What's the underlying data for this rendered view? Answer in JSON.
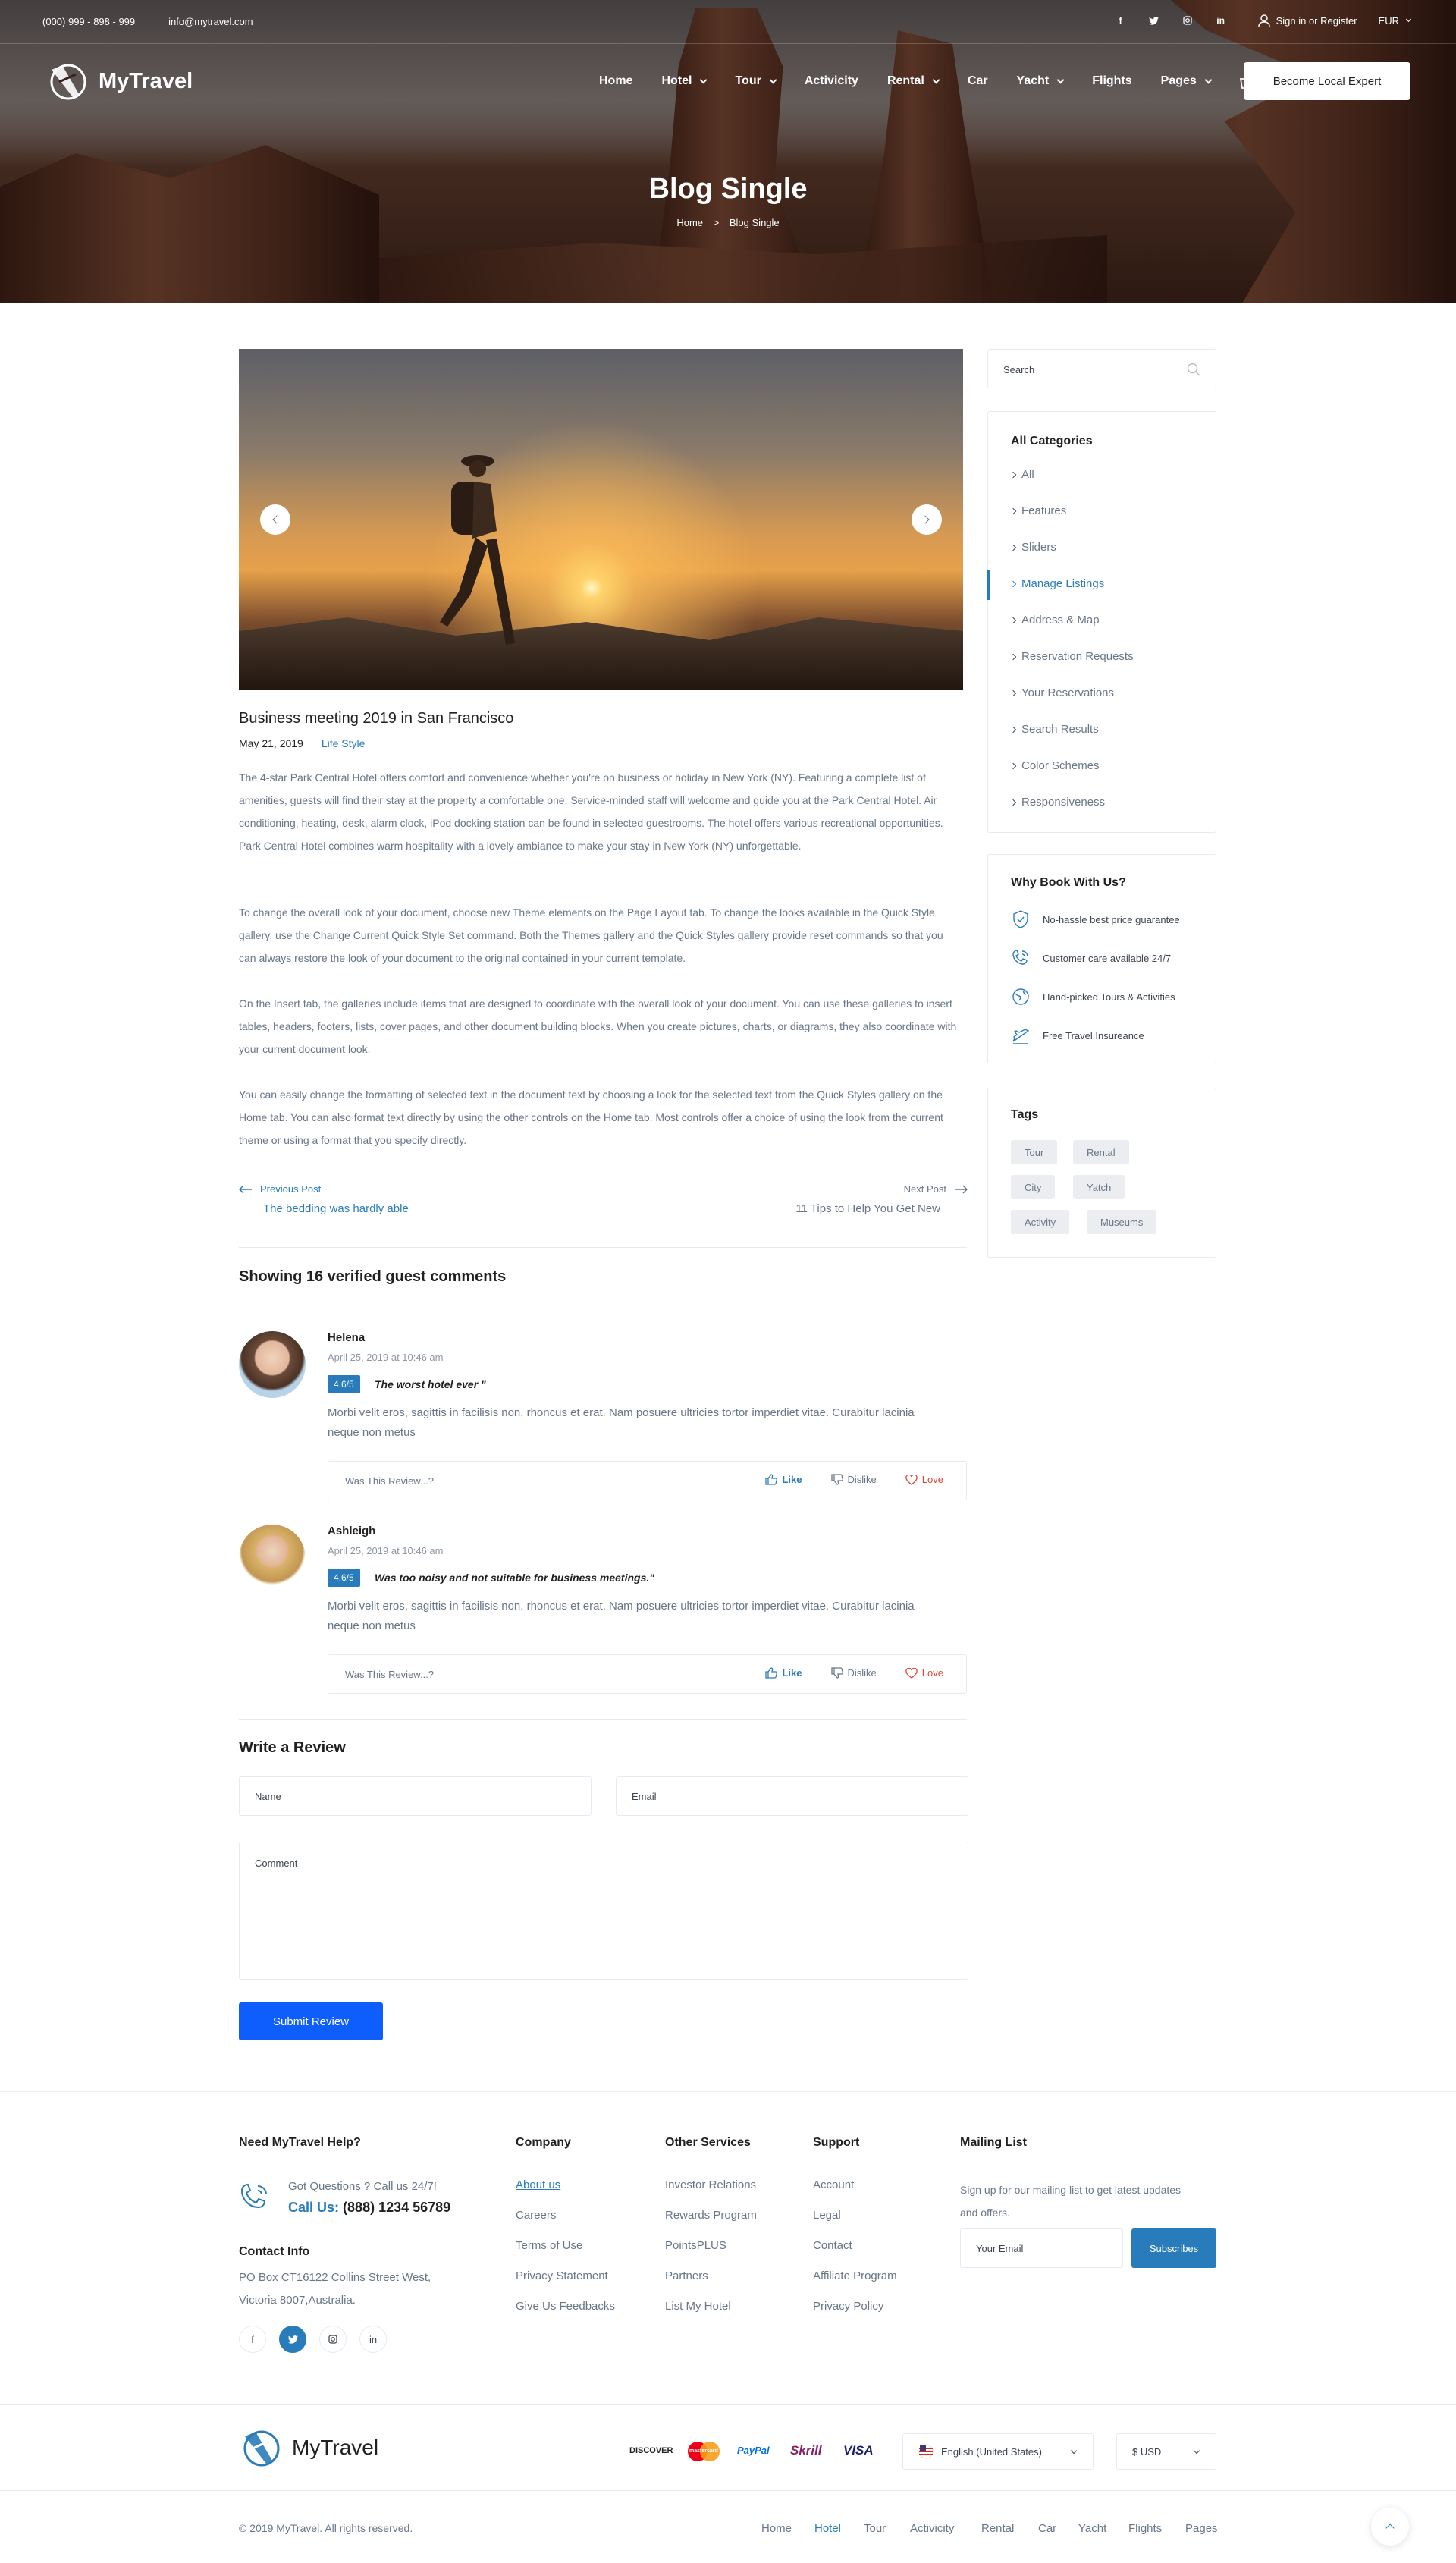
{
  "topbar": {
    "phone": "(000) 999 - 898 - 999",
    "email": "info@mytravel.com",
    "signin": "Sign in or Register",
    "currency": "EUR"
  },
  "brand": {
    "name": "MyTravel"
  },
  "nav": {
    "items": [
      {
        "label": "Home",
        "dropdown": false
      },
      {
        "label": "Hotel",
        "dropdown": true
      },
      {
        "label": "Tour",
        "dropdown": true
      },
      {
        "label": "Activicity",
        "dropdown": false
      },
      {
        "label": "Rental",
        "dropdown": true
      },
      {
        "label": "Car",
        "dropdown": false
      },
      {
        "label": "Yacht",
        "dropdown": true
      },
      {
        "label": "Flights",
        "dropdown": false
      },
      {
        "label": "Pages",
        "dropdown": true
      }
    ],
    "cta": "Become Local Expert"
  },
  "hero": {
    "title": "Blog Single",
    "crumb_home": "Home",
    "crumb_sep": ">",
    "crumb_current": "Blog Single"
  },
  "post": {
    "title": "Business meeting 2019 in San Francisco",
    "date": "May 21, 2019",
    "category": "Life Style",
    "paragraphs": [
      "The 4-star Park Central Hotel offers comfort and convenience whether you're on business or holiday in New York (NY). Featuring a complete list of amenities, guests will find their stay at the property a comfortable one. Service-minded staff will welcome and guide you at the Park Central Hotel. Air conditioning, heating, desk, alarm clock, iPod docking station can be found in selected guestrooms. The hotel offers various recreational opportunities. Park Central Hotel combines warm hospitality with a lovely ambiance to make your stay in New York (NY) unforgettable.",
      "To change the overall look of your document, choose new Theme elements on the Page Layout tab. To change the looks available in the Quick Style gallery, use the Change Current Quick Style Set command. Both the Themes gallery and the Quick Styles gallery provide reset commands so that you can always restore the look of your document to the original contained in your current template.",
      "On the Insert tab, the galleries include items that are designed to coordinate with the overall look of your document. You can use these galleries to insert tables, headers, footers, lists, cover pages, and other document building blocks. When you create pictures, charts, or diagrams, they also coordinate with your current document look.",
      "You can easily change the formatting of selected text in the document text by choosing a look for the selected text from the Quick Styles gallery on the Home tab. You can also format text directly by using the other controls on the Home tab. Most controls offer a choice of using the look from the current theme or using a format that you specify directly."
    ],
    "prev_label": "Previous Post",
    "prev_title": "The bedding was hardly able",
    "next_label": "Next Post",
    "next_title": "11 Tips to Help You Get New"
  },
  "comments": {
    "heading": "Showing 16 verified guest comments",
    "items": [
      {
        "name": "Helena",
        "date": "April 25, 2019 at 10:46 am",
        "rating": "4.6/5",
        "title": "The worst hotel ever \"",
        "text": "Morbi velit eros, sagittis in facilisis non, rhoncus et erat. Nam posuere ultricies tortor imperdiet vitae. Curabitur lacinia neque non metus",
        "question": "Was This Review...?",
        "like": "Like",
        "dislike": "Dislike",
        "love": "Love"
      },
      {
        "name": "Ashleigh",
        "date": "April 25, 2019 at 10:46 am",
        "rating": "4.6/5",
        "title": "Was too noisy and not suitable for business meetings.\"",
        "text": "Morbi velit eros, sagittis in facilisis non, rhoncus et erat. Nam posuere ultricies tortor imperdiet vitae. Curabitur lacinia neque non metus",
        "question": "Was This Review...?",
        "like": "Like",
        "dislike": "Dislike",
        "love": "Love"
      }
    ]
  },
  "review_form": {
    "heading": "Write a Review",
    "name_placeholder": "Name",
    "email_placeholder": "Email",
    "comment_placeholder": "Comment",
    "submit": "Submit Review"
  },
  "sidebar": {
    "search_placeholder": "Search",
    "categories_title": "All Categories",
    "categories": [
      "All",
      "Features",
      "Sliders",
      "Manage Listings",
      "Address & Map",
      "Reservation Requests",
      "Your Reservations",
      "Search Results",
      "Color Schemes",
      "Responsiveness"
    ],
    "active_category": "Manage Listings",
    "why_title": "Why Book With Us?",
    "why": [
      "No-hassle best price guarantee",
      "Customer care available 24/7",
      "Hand-picked Tours & Activities",
      "Free Travel Insureance"
    ],
    "tags_title": "Tags",
    "tags": [
      "Tour",
      "Rental",
      "City",
      "Yatch",
      "Activity",
      "Museums"
    ]
  },
  "footer": {
    "help_title": "Need MyTravel Help?",
    "help_q": "Got Questions ? Call us 24/7!",
    "call_label": "Call Us:",
    "call_number": "(888) 1234 56789",
    "contact_title": "Contact Info",
    "address_1": "PO Box CT16122 Collins Street West,",
    "address_2": "Victoria 8007,Australia.",
    "company_title": "Company",
    "company": [
      "About us",
      "Careers",
      "Terms of Use",
      "Privacy Statement",
      "Give Us Feedbacks"
    ],
    "services_title": "Other Services",
    "services": [
      "Investor Relations",
      "Rewards Program",
      "PointsPLUS",
      "Partners",
      "List My Hotel"
    ],
    "support_title": "Support",
    "support": [
      "Account",
      "Legal",
      "Contact",
      "Affiliate Program",
      "Privacy Policy"
    ],
    "mailing_title": "Mailing List",
    "mailing_text_1": "Sign up for our mailing list to get latest updates",
    "mailing_text_2": "and offers.",
    "email_placeholder": "Your Email",
    "subscribe": "Subscribes",
    "payments": [
      "DISCOVER",
      "mastercard",
      "PayPal",
      "Skrill",
      "VISA"
    ],
    "language": "English (United States)",
    "currency": "$ USD",
    "copyright": "© 2019 MyTravel. All rights reserved.",
    "bottom_nav": [
      "Home",
      "Hotel",
      "Tour",
      "Activicity",
      "Rental",
      "Car",
      "Yacht",
      "Flights",
      "Pages"
    ]
  }
}
